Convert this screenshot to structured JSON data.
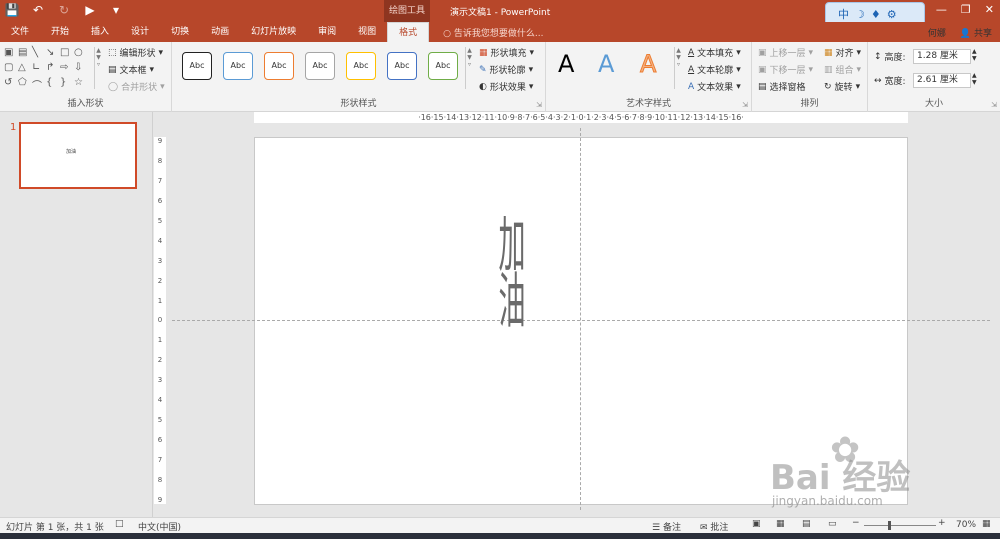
{
  "titlebar": {
    "context_tab": "绘图工具",
    "doc_title": "演示文稿1 - PowerPoint",
    "qat_icons": [
      "save-icon",
      "undo-icon",
      "redo-icon",
      "start-from-beginning-icon",
      "customize-icon"
    ]
  },
  "ime": {
    "lang": "中"
  },
  "tabs": [
    "文件",
    "开始",
    "插入",
    "设计",
    "切换",
    "动画",
    "幻灯片放映",
    "审阅",
    "视图",
    "格式"
  ],
  "active_tab": "格式",
  "tellme": "告诉我您想要做什么...",
  "user": {
    "name": "何娜",
    "share": "共享"
  },
  "ribbon": {
    "insert_shapes": {
      "label": "插入形状",
      "edit_shape": "编辑形状",
      "text_box": "文本框",
      "merge_shapes": "合并形状"
    },
    "shape_styles": {
      "label": "形状样式",
      "presets": [
        "Abc",
        "Abc",
        "Abc",
        "Abc",
        "Abc",
        "Abc",
        "Abc"
      ],
      "preset_colors": [
        "#222222",
        "#5b9bd5",
        "#ed7d31",
        "#a5a5a5",
        "#ffc000",
        "#4472c4",
        "#70ad47"
      ],
      "fill": "形状填充",
      "outline": "形状轮廓",
      "effects": "形状效果"
    },
    "wordart": {
      "label": "艺术字样式",
      "samples": [
        "A",
        "A",
        "A"
      ],
      "fill": "文本填充",
      "outline": "文本轮廓",
      "effects": "文本效果"
    },
    "arrange": {
      "label": "排列",
      "bring_forward": "上移一层",
      "send_backward": "下移一层",
      "selection_pane": "选择窗格",
      "align": "对齐",
      "group": "组合",
      "rotate": "旋转"
    },
    "size": {
      "label": "大小",
      "height_label": "高度:",
      "height_value": "1.28 厘米",
      "width_label": "宽度:",
      "width_value": "2.61 厘米"
    }
  },
  "slides_panel": {
    "number": "1",
    "thumb_text": "加油"
  },
  "rulers": {
    "horizontal": "·16·15·14·13·12·11·10·9·8·7·6·5·4·3·2·1·0·1·2·3·4·5·6·7·8·9·10·11·12·13·14·15·16·",
    "vertical": [
      "9",
      "8",
      "7",
      "6",
      "5",
      "4",
      "3",
      "2",
      "1",
      "0",
      "1",
      "2",
      "3",
      "4",
      "5",
      "6",
      "7",
      "8",
      "9"
    ]
  },
  "slide": {
    "text": "加油"
  },
  "status": {
    "slide_info": "幻灯片 第 1 张，共 1 张",
    "language": "中文(中国)",
    "notes": "备注",
    "comments": "批注",
    "zoom": "70%"
  },
  "watermark": {
    "main": "Bai 经验",
    "sub": "jingyan.baidu.com"
  }
}
